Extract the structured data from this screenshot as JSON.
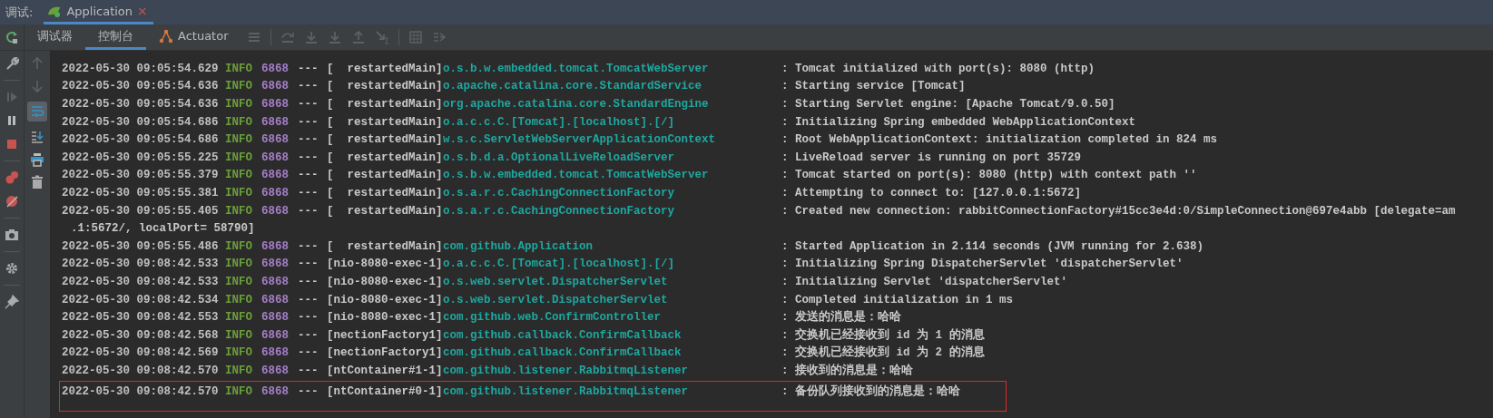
{
  "header": {
    "label": "调试:",
    "tabs": [
      {
        "title": "Application",
        "selected": true,
        "close": "×"
      }
    ]
  },
  "toolbar": {
    "tabs": [
      {
        "label": "调试器",
        "selected": false
      },
      {
        "label": "控制台",
        "selected": true
      },
      {
        "label": "Actuator",
        "selected": false
      }
    ]
  },
  "console_tools": {
    "soft_wrap_on": true
  },
  "log": [
    {
      "kind": "entry",
      "highlighted": false,
      "time": "2022-05-30 09:05:54.629",
      "level": "INFO",
      "pid": "6868",
      "sep": "---",
      "thread": "[  restartedMain]",
      "logger": "o.s.b.w.embedded.tomcat.TomcatWebServer",
      "colon": ":",
      "message": "Tomcat initialized with port(s): 8080 (http)"
    },
    {
      "kind": "entry",
      "highlighted": false,
      "time": "2022-05-30 09:05:54.636",
      "level": "INFO",
      "pid": "6868",
      "sep": "---",
      "thread": "[  restartedMain]",
      "logger": "o.apache.catalina.core.StandardService",
      "colon": ":",
      "message": "Starting service [Tomcat]"
    },
    {
      "kind": "entry",
      "highlighted": false,
      "time": "2022-05-30 09:05:54.636",
      "level": "INFO",
      "pid": "6868",
      "sep": "---",
      "thread": "[  restartedMain]",
      "logger": "org.apache.catalina.core.StandardEngine",
      "colon": ":",
      "message": "Starting Servlet engine: [Apache Tomcat/9.0.50]"
    },
    {
      "kind": "entry",
      "highlighted": false,
      "time": "2022-05-30 09:05:54.686",
      "level": "INFO",
      "pid": "6868",
      "sep": "---",
      "thread": "[  restartedMain]",
      "logger": "o.a.c.c.C.[Tomcat].[localhost].[/]",
      "colon": ":",
      "message": "Initializing Spring embedded WebApplicationContext"
    },
    {
      "kind": "entry",
      "highlighted": false,
      "time": "2022-05-30 09:05:54.686",
      "level": "INFO",
      "pid": "6868",
      "sep": "---",
      "thread": "[  restartedMain]",
      "logger": "w.s.c.ServletWebServerApplicationContext",
      "colon": ":",
      "message": "Root WebApplicationContext: initialization completed in 824 ms"
    },
    {
      "kind": "entry",
      "highlighted": false,
      "time": "2022-05-30 09:05:55.225",
      "level": "INFO",
      "pid": "6868",
      "sep": "---",
      "thread": "[  restartedMain]",
      "logger": "o.s.b.d.a.OptionalLiveReloadServer",
      "colon": ":",
      "message": "LiveReload server is running on port 35729"
    },
    {
      "kind": "entry",
      "highlighted": false,
      "time": "2022-05-30 09:05:55.379",
      "level": "INFO",
      "pid": "6868",
      "sep": "---",
      "thread": "[  restartedMain]",
      "logger": "o.s.b.w.embedded.tomcat.TomcatWebServer",
      "colon": ":",
      "message": "Tomcat started on port(s): 8080 (http) with context path ''"
    },
    {
      "kind": "entry",
      "highlighted": false,
      "time": "2022-05-30 09:05:55.381",
      "level": "INFO",
      "pid": "6868",
      "sep": "---",
      "thread": "[  restartedMain]",
      "logger": "o.s.a.r.c.CachingConnectionFactory",
      "colon": ":",
      "message": "Attempting to connect to: [127.0.0.1:5672]"
    },
    {
      "kind": "entry",
      "highlighted": false,
      "time": "2022-05-30 09:05:55.405",
      "level": "INFO",
      "pid": "6868",
      "sep": "---",
      "thread": "[  restartedMain]",
      "logger": "o.s.a.r.c.CachingConnectionFactory",
      "colon": ":",
      "message": "Created new connection: rabbitConnectionFactory#15cc3e4d:0/SimpleConnection@697e4abb [delegate=am"
    },
    {
      "kind": "continuation",
      "message": ".1:5672/, localPort= 58790]"
    },
    {
      "kind": "entry",
      "highlighted": false,
      "time": "2022-05-30 09:05:55.486",
      "level": "INFO",
      "pid": "6868",
      "sep": "---",
      "thread": "[  restartedMain]",
      "logger": "com.github.Application",
      "colon": ":",
      "message": "Started Application in 2.114 seconds (JVM running for 2.638)"
    },
    {
      "kind": "entry",
      "highlighted": false,
      "time": "2022-05-30 09:08:42.533",
      "level": "INFO",
      "pid": "6868",
      "sep": "---",
      "thread": "[nio-8080-exec-1]",
      "logger": "o.a.c.c.C.[Tomcat].[localhost].[/]",
      "colon": ":",
      "message": "Initializing Spring DispatcherServlet 'dispatcherServlet'"
    },
    {
      "kind": "entry",
      "highlighted": false,
      "time": "2022-05-30 09:08:42.533",
      "level": "INFO",
      "pid": "6868",
      "sep": "---",
      "thread": "[nio-8080-exec-1]",
      "logger": "o.s.web.servlet.DispatcherServlet",
      "colon": ":",
      "message": "Initializing Servlet 'dispatcherServlet'"
    },
    {
      "kind": "entry",
      "highlighted": false,
      "time": "2022-05-30 09:08:42.534",
      "level": "INFO",
      "pid": "6868",
      "sep": "---",
      "thread": "[nio-8080-exec-1]",
      "logger": "o.s.web.servlet.DispatcherServlet",
      "colon": ":",
      "message": "Completed initialization in 1 ms"
    },
    {
      "kind": "entry",
      "highlighted": false,
      "time": "2022-05-30 09:08:42.553",
      "level": "INFO",
      "pid": "6868",
      "sep": "---",
      "thread": "[nio-8080-exec-1]",
      "logger": "com.github.web.ConfirmController",
      "colon": ":",
      "message": "发送的消息是：哈哈"
    },
    {
      "kind": "entry",
      "highlighted": false,
      "time": "2022-05-30 09:08:42.568",
      "level": "INFO",
      "pid": "6868",
      "sep": "---",
      "thread": "[nectionFactory1]",
      "logger": "com.github.callback.ConfirmCallback",
      "colon": ":",
      "message": "交换机已经接收到 id 为 1 的消息"
    },
    {
      "kind": "entry",
      "highlighted": false,
      "time": "2022-05-30 09:08:42.569",
      "level": "INFO",
      "pid": "6868",
      "sep": "---",
      "thread": "[nectionFactory1]",
      "logger": "com.github.callback.ConfirmCallback",
      "colon": ":",
      "message": "交换机已经接收到 id 为 2 的消息"
    },
    {
      "kind": "entry",
      "highlighted": false,
      "time": "2022-05-30 09:08:42.570",
      "level": "INFO",
      "pid": "6868",
      "sep": "---",
      "thread": "[ntContainer#1-1]",
      "logger": "com.github.listener.RabbitmqListener",
      "colon": ":",
      "message": "接收到的消息是：哈哈"
    },
    {
      "kind": "entry",
      "highlighted": true,
      "time": "2022-05-30 09:08:42.570",
      "level": "INFO",
      "pid": "6868",
      "sep": "---",
      "thread": "[ntContainer#0-1]",
      "logger": "com.github.listener.RabbitmqListener",
      "colon": ":",
      "message": "备份队列接收到的消息是：哈哈"
    }
  ]
}
